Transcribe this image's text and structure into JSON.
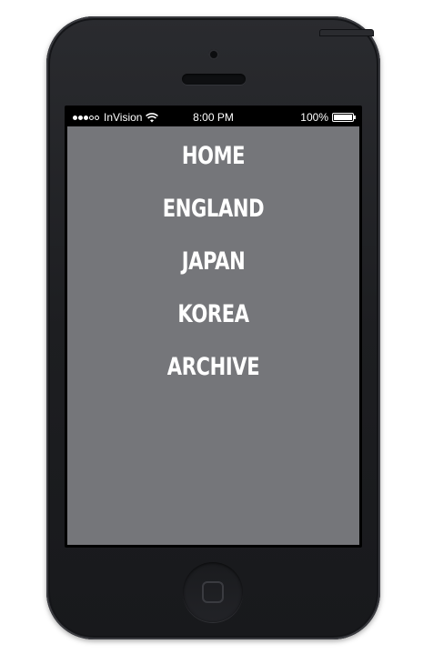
{
  "status_bar": {
    "carrier": "InVision",
    "signal_bars_filled": 3,
    "signal_bars_total": 5,
    "time": "8:00 PM",
    "battery_percent_label": "100%",
    "battery_level": 1.0
  },
  "icons": {
    "wifi": "wifi-icon",
    "battery": "battery-icon",
    "home": "home-square-icon"
  },
  "colors": {
    "phone_body": "#1d1e21",
    "screen_background": "#75767a",
    "nav_text": "#ffffff"
  },
  "nav": {
    "items": [
      {
        "label": "HOME"
      },
      {
        "label": "ENGLAND"
      },
      {
        "label": "JAPAN"
      },
      {
        "label": "KOREA"
      },
      {
        "label": "ARCHIVE"
      }
    ]
  }
}
